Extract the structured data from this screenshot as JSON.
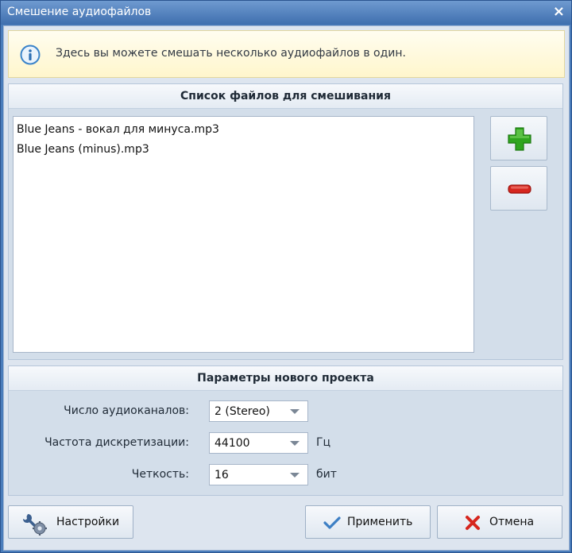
{
  "window": {
    "title": "Смешение аудиофайлов",
    "close_label": "×"
  },
  "info": {
    "text": "Здесь вы можете смешать несколько аудиофайлов в один."
  },
  "files": {
    "header": "Список файлов для смешивания",
    "items": [
      "Blue Jeans - вокал  для минуса.mp3",
      "Blue Jeans (minus).mp3"
    ]
  },
  "params": {
    "header": "Параметры нового проекта",
    "channels": {
      "label": "Число аудиоканалов:",
      "value": "2 (Stereo)",
      "unit": ""
    },
    "rate": {
      "label": "Частота дискретизации:",
      "value": "44100",
      "unit": "Гц"
    },
    "depth": {
      "label": "Четкость:",
      "value": "16",
      "unit": "бит"
    }
  },
  "buttons": {
    "settings": "Настройки",
    "apply": "Применить",
    "cancel": "Отмена"
  },
  "icons": {
    "info": "info-icon",
    "add": "plus-icon",
    "remove": "minus-icon",
    "settings": "gear-wrench-icon",
    "apply": "checkmark-icon",
    "cancel": "cross-icon"
  },
  "colors": {
    "add_green": "#2fa51e",
    "remove_red": "#d6261e",
    "titlebar": "#4a7dbb"
  }
}
